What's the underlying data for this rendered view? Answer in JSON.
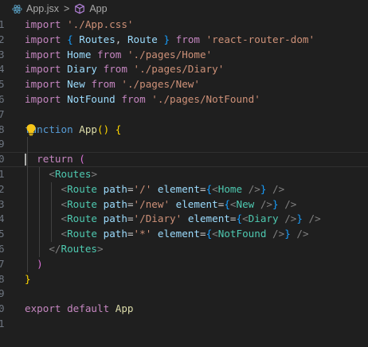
{
  "breadcrumb": {
    "file_name": "App.jsx",
    "separator": ">",
    "symbol_name": "App",
    "file_icon": "react-icon",
    "symbol_icon": "cube-icon"
  },
  "editor": {
    "line_numbers": [
      "1",
      "2",
      "3",
      "4",
      "5",
      "6",
      "7",
      "8",
      "9",
      "0",
      "1",
      "2",
      "3",
      "4",
      "5",
      "6",
      "7",
      "8",
      "9",
      "0",
      "1"
    ],
    "current_line_index": 9,
    "lightbulb_line_index": 7,
    "lines": [
      [
        {
          "t": "import",
          "c": "kw"
        },
        {
          "t": " ",
          "c": "pl"
        },
        {
          "t": "'./App.css'",
          "c": "str"
        }
      ],
      [
        {
          "t": "import",
          "c": "kw"
        },
        {
          "t": " ",
          "c": "pl"
        },
        {
          "t": "{",
          "c": "br3"
        },
        {
          "t": " ",
          "c": "pl"
        },
        {
          "t": "Routes",
          "c": "var"
        },
        {
          "t": ", ",
          "c": "pl"
        },
        {
          "t": "Route",
          "c": "var"
        },
        {
          "t": " ",
          "c": "pl"
        },
        {
          "t": "}",
          "c": "br3"
        },
        {
          "t": " ",
          "c": "pl"
        },
        {
          "t": "from",
          "c": "kw"
        },
        {
          "t": " ",
          "c": "pl"
        },
        {
          "t": "'react-router-dom'",
          "c": "str"
        }
      ],
      [
        {
          "t": "import",
          "c": "kw"
        },
        {
          "t": " ",
          "c": "pl"
        },
        {
          "t": "Home",
          "c": "var"
        },
        {
          "t": " ",
          "c": "pl"
        },
        {
          "t": "from",
          "c": "kw"
        },
        {
          "t": " ",
          "c": "pl"
        },
        {
          "t": "'./pages/Home'",
          "c": "str"
        }
      ],
      [
        {
          "t": "import",
          "c": "kw"
        },
        {
          "t": " ",
          "c": "pl"
        },
        {
          "t": "Diary",
          "c": "var"
        },
        {
          "t": " ",
          "c": "pl"
        },
        {
          "t": "from",
          "c": "kw"
        },
        {
          "t": " ",
          "c": "pl"
        },
        {
          "t": "'./pages/Diary'",
          "c": "str"
        }
      ],
      [
        {
          "t": "import",
          "c": "kw"
        },
        {
          "t": " ",
          "c": "pl"
        },
        {
          "t": "New",
          "c": "var"
        },
        {
          "t": " ",
          "c": "pl"
        },
        {
          "t": "from",
          "c": "kw"
        },
        {
          "t": " ",
          "c": "pl"
        },
        {
          "t": "'./pages/New'",
          "c": "str"
        }
      ],
      [
        {
          "t": "import",
          "c": "kw"
        },
        {
          "t": " ",
          "c": "pl"
        },
        {
          "t": "NotFound",
          "c": "var"
        },
        {
          "t": " ",
          "c": "pl"
        },
        {
          "t": "from",
          "c": "kw"
        },
        {
          "t": " ",
          "c": "pl"
        },
        {
          "t": "'./pages/NotFound'",
          "c": "str"
        }
      ],
      [],
      [
        {
          "t": "function",
          "c": "bl"
        },
        {
          "t": " ",
          "c": "pl"
        },
        {
          "t": "App",
          "c": "fn"
        },
        {
          "t": "()",
          "c": "br1"
        },
        {
          "t": " ",
          "c": "pl"
        },
        {
          "t": "{",
          "c": "br1"
        }
      ],
      [],
      [
        {
          "t": "  ",
          "c": "pl"
        },
        {
          "t": "return",
          "c": "kw"
        },
        {
          "t": " ",
          "c": "pl"
        },
        {
          "t": "(",
          "c": "br2"
        }
      ],
      [
        {
          "t": "    ",
          "c": "pl"
        },
        {
          "t": "<",
          "c": "ang"
        },
        {
          "t": "Routes",
          "c": "tag"
        },
        {
          "t": ">",
          "c": "ang"
        }
      ],
      [
        {
          "t": "      ",
          "c": "pl"
        },
        {
          "t": "<",
          "c": "ang"
        },
        {
          "t": "Route",
          "c": "tag"
        },
        {
          "t": " ",
          "c": "pl"
        },
        {
          "t": "path",
          "c": "attr"
        },
        {
          "t": "=",
          "c": "pl"
        },
        {
          "t": "'/'",
          "c": "str"
        },
        {
          "t": " ",
          "c": "pl"
        },
        {
          "t": "element",
          "c": "attr"
        },
        {
          "t": "=",
          "c": "pl"
        },
        {
          "t": "{",
          "c": "br3"
        },
        {
          "t": "<",
          "c": "ang"
        },
        {
          "t": "Home",
          "c": "tag"
        },
        {
          "t": " ",
          "c": "pl"
        },
        {
          "t": "/>",
          "c": "ang"
        },
        {
          "t": "}",
          "c": "br3"
        },
        {
          "t": " ",
          "c": "pl"
        },
        {
          "t": "/>",
          "c": "ang"
        }
      ],
      [
        {
          "t": "      ",
          "c": "pl"
        },
        {
          "t": "<",
          "c": "ang"
        },
        {
          "t": "Route",
          "c": "tag"
        },
        {
          "t": " ",
          "c": "pl"
        },
        {
          "t": "path",
          "c": "attr"
        },
        {
          "t": "=",
          "c": "pl"
        },
        {
          "t": "'/new'",
          "c": "str"
        },
        {
          "t": " ",
          "c": "pl"
        },
        {
          "t": "element",
          "c": "attr"
        },
        {
          "t": "=",
          "c": "pl"
        },
        {
          "t": "{",
          "c": "br3"
        },
        {
          "t": "<",
          "c": "ang"
        },
        {
          "t": "New",
          "c": "tag"
        },
        {
          "t": " ",
          "c": "pl"
        },
        {
          "t": "/>",
          "c": "ang"
        },
        {
          "t": "}",
          "c": "br3"
        },
        {
          "t": " ",
          "c": "pl"
        },
        {
          "t": "/>",
          "c": "ang"
        }
      ],
      [
        {
          "t": "      ",
          "c": "pl"
        },
        {
          "t": "<",
          "c": "ang"
        },
        {
          "t": "Route",
          "c": "tag"
        },
        {
          "t": " ",
          "c": "pl"
        },
        {
          "t": "path",
          "c": "attr"
        },
        {
          "t": "=",
          "c": "pl"
        },
        {
          "t": "'/Diary'",
          "c": "str"
        },
        {
          "t": " ",
          "c": "pl"
        },
        {
          "t": "element",
          "c": "attr"
        },
        {
          "t": "=",
          "c": "pl"
        },
        {
          "t": "{",
          "c": "br3"
        },
        {
          "t": "<",
          "c": "ang"
        },
        {
          "t": "Diary",
          "c": "tag"
        },
        {
          "t": " ",
          "c": "pl"
        },
        {
          "t": "/>",
          "c": "ang"
        },
        {
          "t": "}",
          "c": "br3"
        },
        {
          "t": " ",
          "c": "pl"
        },
        {
          "t": "/>",
          "c": "ang"
        }
      ],
      [
        {
          "t": "      ",
          "c": "pl"
        },
        {
          "t": "<",
          "c": "ang"
        },
        {
          "t": "Route",
          "c": "tag"
        },
        {
          "t": " ",
          "c": "pl"
        },
        {
          "t": "path",
          "c": "attr"
        },
        {
          "t": "=",
          "c": "pl"
        },
        {
          "t": "'*'",
          "c": "str"
        },
        {
          "t": " ",
          "c": "pl"
        },
        {
          "t": "element",
          "c": "attr"
        },
        {
          "t": "=",
          "c": "pl"
        },
        {
          "t": "{",
          "c": "br3"
        },
        {
          "t": "<",
          "c": "ang"
        },
        {
          "t": "NotFound",
          "c": "tag"
        },
        {
          "t": " ",
          "c": "pl"
        },
        {
          "t": "/>",
          "c": "ang"
        },
        {
          "t": "}",
          "c": "br3"
        },
        {
          "t": " ",
          "c": "pl"
        },
        {
          "t": "/>",
          "c": "ang"
        }
      ],
      [
        {
          "t": "    ",
          "c": "pl"
        },
        {
          "t": "</",
          "c": "ang"
        },
        {
          "t": "Routes",
          "c": "tag"
        },
        {
          "t": ">",
          "c": "ang"
        }
      ],
      [
        {
          "t": "  ",
          "c": "pl"
        },
        {
          "t": ")",
          "c": "br2"
        }
      ],
      [
        {
          "t": "}",
          "c": "br1"
        }
      ],
      [],
      [
        {
          "t": "export",
          "c": "kw"
        },
        {
          "t": " ",
          "c": "pl"
        },
        {
          "t": "default",
          "c": "kw"
        },
        {
          "t": " ",
          "c": "pl"
        },
        {
          "t": "App",
          "c": "fn"
        }
      ],
      []
    ]
  }
}
